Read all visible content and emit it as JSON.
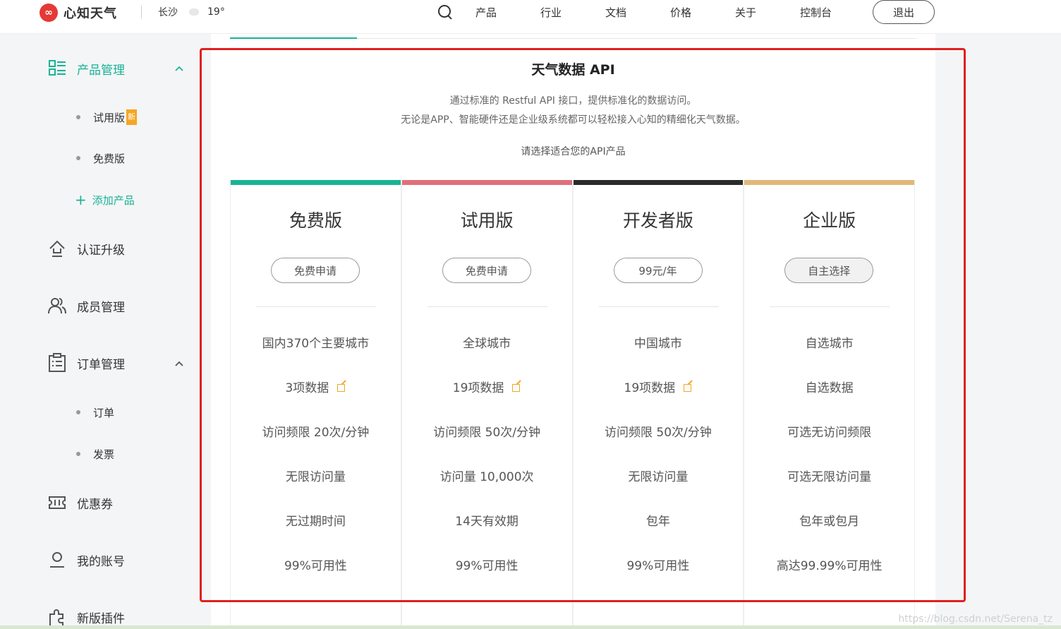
{
  "header": {
    "logo_mark": "∞",
    "logo_text": "心知天气",
    "city": "长沙",
    "temperature": "19°",
    "nav": [
      "产品",
      "行业",
      "文档",
      "价格",
      "关于",
      "控制台"
    ],
    "logout": "退出"
  },
  "sidebar": {
    "product_mgmt": "产品管理",
    "trial": "试用版",
    "new_badge": "新",
    "free": "免费版",
    "add_product": "添加产品",
    "cert_upgrade": "认证升级",
    "members": "成员管理",
    "orders_mgmt": "订单管理",
    "orders": "订单",
    "invoice": "发票",
    "coupons": "优惠券",
    "account": "我的账号",
    "plugin": "新版插件"
  },
  "main": {
    "title": "天气数据 API",
    "desc1": "通过标准的 Restful API 接口，提供标准化的数据访问。",
    "desc2": "无论是APP、智能硬件还是企业级系统都可以轻松接入心知的精细化天气数据。",
    "choose": "请选择适合您的API产品"
  },
  "plans": [
    {
      "name": "免费版",
      "button": "免费申请",
      "color": "#1ab394",
      "features": [
        "国内370个主要城市",
        "3项数据",
        "访问频限 20次/分钟",
        "无限访问量",
        "无过期时间",
        "99%可用性"
      ]
    },
    {
      "name": "试用版",
      "button": "免费申请",
      "color": "#e0707a",
      "features": [
        "全球城市",
        "19项数据",
        "访问频限 50次/分钟",
        "访问量 10,000次",
        "14天有效期",
        "99%可用性"
      ]
    },
    {
      "name": "开发者版",
      "button": "99元/年",
      "color": "#2b2b2b",
      "features": [
        "中国城市",
        "19项数据",
        "访问频限 50次/分钟",
        "无限访问量",
        "包年",
        "99%可用性"
      ]
    },
    {
      "name": "企业版",
      "button": "自主选择",
      "color": "#e0b978",
      "features": [
        "自选城市",
        "自选数据",
        "可选无访问频限",
        "可选无限访问量",
        "包年或包月",
        "高达99.99%可用性"
      ]
    }
  ],
  "watermark": "https://blog.csdn.net/Serena_tz",
  "accent_color": "#19b394",
  "highlight_color": "#e0201f"
}
